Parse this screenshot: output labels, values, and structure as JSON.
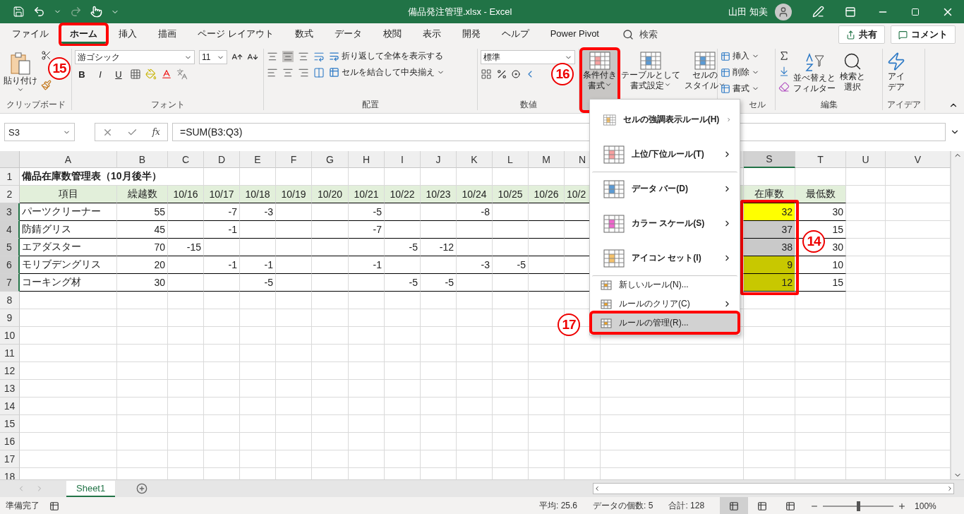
{
  "window": {
    "title": "備品発注管理.xlsx  -  Excel",
    "user": "山田 知美"
  },
  "tabs": [
    {
      "label": "ファイル",
      "selected": false,
      "highlighted": false
    },
    {
      "label": "ホーム",
      "selected": true,
      "highlighted": true
    },
    {
      "label": "挿入",
      "selected": false,
      "highlighted": false
    },
    {
      "label": "描画",
      "selected": false,
      "highlighted": false
    },
    {
      "label": "ページ レイアウト",
      "selected": false,
      "highlighted": false
    },
    {
      "label": "数式",
      "selected": false,
      "highlighted": false
    },
    {
      "label": "データ",
      "selected": false,
      "highlighted": false
    },
    {
      "label": "校閲",
      "selected": false,
      "highlighted": false
    },
    {
      "label": "表示",
      "selected": false,
      "highlighted": false
    },
    {
      "label": "開発",
      "selected": false,
      "highlighted": false
    },
    {
      "label": "ヘルプ",
      "selected": false,
      "highlighted": false
    },
    {
      "label": "Power Pivot",
      "selected": false,
      "highlighted": false
    }
  ],
  "search": {
    "placeholder": "検索"
  },
  "share_button": "共有",
  "comment_button": "コメント",
  "ribbon": {
    "clipboard": {
      "paste": "貼り付け",
      "label": "クリップボード",
      "callout": "15"
    },
    "font": {
      "name": "游ゴシック",
      "size": "11",
      "styles": [
        "B",
        "I",
        "U"
      ],
      "label": "フォント"
    },
    "alignment": {
      "wrap": "折り返して全体を表示する",
      "merge": "セルを結合して中央揃え",
      "label": "配置"
    },
    "number": {
      "format": "標準",
      "label": "数値"
    },
    "styles": [
      {
        "lines": [
          "条件付き",
          "書式"
        ],
        "highlighted": true,
        "callout": "16"
      },
      {
        "lines": [
          "テーブルとして",
          "書式設定"
        ],
        "highlighted": false
      },
      {
        "lines": [
          "セルの",
          "スタイル"
        ],
        "highlighted": false
      }
    ],
    "cells": {
      "items": [
        "挿入",
        "削除",
        "書式"
      ],
      "label": "セル"
    },
    "editing": {
      "sort": [
        "並べ替えと",
        "フィルター"
      ],
      "find": [
        "検索と",
        "選択"
      ],
      "label": "編集"
    },
    "ideas": {
      "lines": [
        "アイ",
        "デア"
      ],
      "label": "アイデア"
    }
  },
  "formula_bar": {
    "name_box": "S3",
    "function_label": "fx",
    "formula": "=SUM(B3:Q3)"
  },
  "sheet": {
    "columns": [
      {
        "label": "A",
        "selected": false
      },
      {
        "label": "B",
        "selected": false
      },
      {
        "label": "C",
        "selected": false
      },
      {
        "label": "D",
        "selected": false
      },
      {
        "label": "E",
        "selected": false
      },
      {
        "label": "F",
        "selected": false
      },
      {
        "label": "G",
        "selected": false
      },
      {
        "label": "H",
        "selected": false
      },
      {
        "label": "I",
        "selected": false
      },
      {
        "label": "J",
        "selected": false
      },
      {
        "label": "K",
        "selected": false
      },
      {
        "label": "L",
        "selected": false
      },
      {
        "label": "M",
        "selected": false
      },
      {
        "label": "N",
        "selected": false
      },
      {
        "label": "S",
        "selected": true
      },
      {
        "label": "T",
        "selected": false
      },
      {
        "label": "U",
        "selected": false
      },
      {
        "label": "V",
        "selected": false
      }
    ],
    "rows": [
      {
        "label": "1",
        "kind": "title",
        "selected": false,
        "cells": [
          "備品在庫数管理表（10月後半）"
        ]
      },
      {
        "label": "2",
        "kind": "header",
        "selected": false,
        "cells": [
          "項目",
          "繰越数",
          "10/16",
          "10/17",
          "10/18",
          "10/19",
          "10/20",
          "10/21",
          "10/22",
          "10/23",
          "10/24",
          "10/25",
          "10/26",
          "10/2",
          "在庫数",
          "最低数"
        ]
      },
      {
        "label": "3",
        "kind": "data",
        "selected": true,
        "cells": [
          "パーツクリーナー",
          "55",
          null,
          "-7",
          "-3",
          null,
          null,
          "-5",
          null,
          null,
          "-8",
          null,
          null,
          null,
          {
            "text": "32",
            "color": "#ffff00"
          },
          "30"
        ]
      },
      {
        "label": "4",
        "kind": "data",
        "selected": true,
        "cells": [
          "防錆グリス",
          "45",
          null,
          "-1",
          null,
          null,
          null,
          "-7",
          null,
          null,
          null,
          null,
          null,
          null,
          {
            "text": "37",
            "color": "#c9c9c9"
          },
          "15"
        ]
      },
      {
        "label": "5",
        "kind": "data",
        "selected": true,
        "cells": [
          "エアダスター",
          "70",
          "-15",
          null,
          null,
          null,
          null,
          null,
          "-5",
          "-12",
          null,
          null,
          null,
          null,
          {
            "text": "38",
            "color": "#c9c9c9"
          },
          "30"
        ]
      },
      {
        "label": "6",
        "kind": "data",
        "selected": true,
        "cells": [
          "モリブデングリス",
          "20",
          null,
          "-1",
          "-1",
          null,
          null,
          "-1",
          null,
          null,
          "-3",
          "-5",
          null,
          null,
          {
            "text": "9",
            "color": "#c8c800"
          },
          "10"
        ]
      },
      {
        "label": "7",
        "kind": "data",
        "selected": true,
        "cells": [
          "コーキング材",
          "30",
          null,
          null,
          "-5",
          null,
          null,
          null,
          "-5",
          "-5",
          null,
          null,
          null,
          null,
          {
            "text": "12",
            "color": "#c8c800"
          },
          "15"
        ]
      },
      {
        "label": "8",
        "kind": "empty",
        "selected": false
      },
      {
        "label": "9",
        "kind": "empty",
        "selected": false
      },
      {
        "label": "10",
        "kind": "empty",
        "selected": false
      },
      {
        "label": "11",
        "kind": "empty",
        "selected": false
      },
      {
        "label": "12",
        "kind": "empty",
        "selected": false
      },
      {
        "label": "13",
        "kind": "empty",
        "selected": false
      },
      {
        "label": "14",
        "kind": "empty",
        "selected": false
      },
      {
        "label": "15",
        "kind": "empty",
        "selected": false
      },
      {
        "label": "16",
        "kind": "empty",
        "selected": false
      },
      {
        "label": "17",
        "kind": "empty",
        "selected": false
      },
      {
        "label": "18",
        "kind": "empty",
        "selected": false
      }
    ],
    "range_highlight": {
      "callout": "14"
    }
  },
  "menu": {
    "items": [
      {
        "label": "セルの強調表示ルール(H)",
        "kind": "large",
        "submenu": true,
        "divider_above": false,
        "highlighted": false
      },
      {
        "label": "上位/下位ルール(T)",
        "kind": "large",
        "submenu": true,
        "divider_above": false,
        "highlighted": false
      },
      {
        "label": "データ バー(D)",
        "kind": "large",
        "submenu": true,
        "divider_above": true,
        "highlighted": false
      },
      {
        "label": "カラー スケール(S)",
        "kind": "large",
        "submenu": true,
        "divider_above": false,
        "highlighted": false
      },
      {
        "label": "アイコン セット(I)",
        "kind": "large",
        "submenu": true,
        "divider_above": false,
        "highlighted": false
      },
      {
        "label": "新しいルール(N)...",
        "kind": "small",
        "submenu": false,
        "divider_above": true,
        "highlighted": false
      },
      {
        "label": "ルールのクリア(C)",
        "kind": "small",
        "submenu": true,
        "divider_above": false,
        "highlighted": false
      },
      {
        "label": "ルールの管理(R)...",
        "kind": "small",
        "submenu": false,
        "divider_above": false,
        "highlighted": true,
        "callout": "17"
      }
    ]
  },
  "sheet_tabs": [
    {
      "label": "Sheet1",
      "selected": true
    }
  ],
  "status_bar": {
    "mode": "準備完了",
    "stats": [
      "平均: 25.6",
      "データの個数: 5",
      "合計: 128"
    ],
    "views": [
      {
        "selected": true
      },
      {
        "selected": false
      },
      {
        "selected": false
      }
    ],
    "zoom": {
      "level": 0.5,
      "reading": "100%"
    }
  }
}
